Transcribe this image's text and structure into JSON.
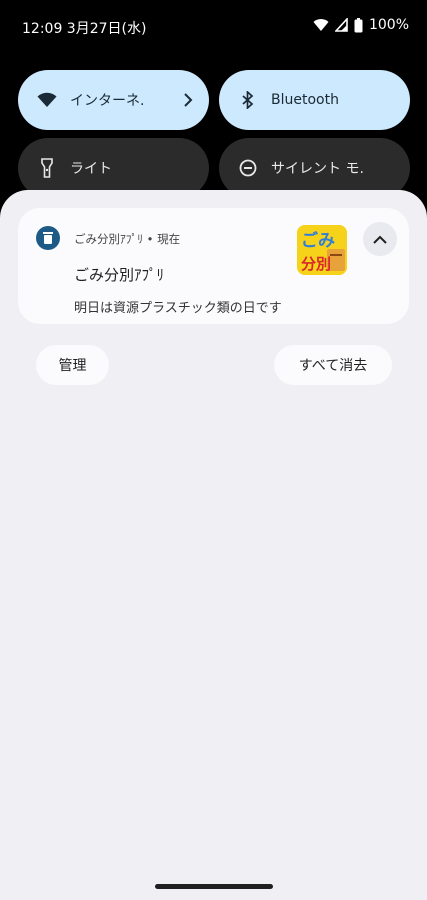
{
  "status_bar": {
    "time": "12:09 3月27日(水)",
    "battery": "100%"
  },
  "quick_settings": {
    "tiles": [
      {
        "label": "インターネ.",
        "icon": "wifi-icon",
        "state": "on"
      },
      {
        "label": "Bluetooth",
        "icon": "bluetooth-icon",
        "state": "on"
      },
      {
        "label": "ライト",
        "icon": "flashlight-icon",
        "state": "off"
      },
      {
        "label": "サイレント モ.",
        "icon": "do-not-disturb-icon",
        "state": "off"
      }
    ]
  },
  "notification": {
    "header": "ごみ分別ｱﾌﾟﾘ • 現在",
    "title": "ごみ分別ｱﾌﾟﾘ",
    "body": "明日は資源プラスチック類の日です",
    "large_icon_text": [
      "ごみ",
      "分別"
    ]
  },
  "actions": {
    "manage": "管理",
    "clear_all": "すべて消去"
  },
  "colors": {
    "tile_on": "#cde9fd",
    "tile_off": "#2b2b2b",
    "shade_bg": "#f0f0f4",
    "card_bg": "#fbfbfd",
    "app_icon": "#1e5a86",
    "large_icon_bg": "#f6d21a"
  }
}
